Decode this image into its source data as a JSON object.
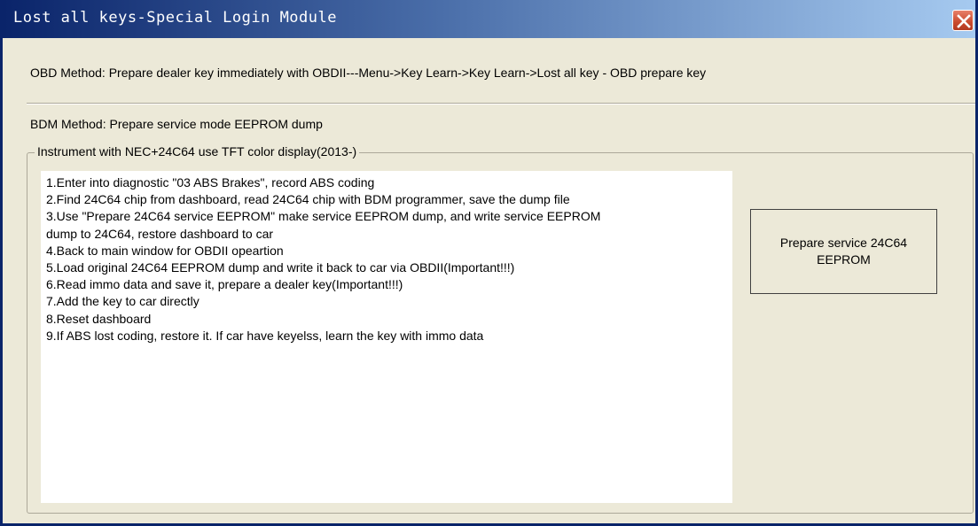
{
  "window": {
    "title": "Lost all keys-Special Login Module",
    "close_label": "Close"
  },
  "obd_method": "OBD Method: Prepare dealer key immediately with OBDII---Menu->Key Learn->Key Learn->Lost all key - OBD prepare key",
  "bdm_method": "BDM Method: Prepare service mode EEPROM dump",
  "group": {
    "title": "Instrument with NEC+24C64 use TFT color display(2013-)",
    "steps": [
      "1.Enter into diagnostic \"03 ABS Brakes\", record ABS coding",
      "2.Find 24C64 chip from dashboard, read 24C64 chip with BDM programmer, save the dump file",
      "3.Use \"Prepare 24C64 service EEPROM\" make service EEPROM dump, and write service EEPROM",
      "dump to 24C64, restore dashboard to car",
      "4.Back to main window for OBDII opeartion",
      "5.Load original 24C64 EEPROM dump and write it back to car via OBDII(Important!!!)",
      "6.Read immo data and save it, prepare a dealer key(Important!!!)",
      "7.Add the key to car directly",
      "8.Reset dashboard",
      "9.If ABS lost coding, restore it. If car have keyelss, learn the key with immo data"
    ],
    "button": {
      "line1": "Prepare service 24C64",
      "line2": "EEPROM"
    }
  },
  "colors": {
    "title_gradient_start": "#0a246a",
    "title_gradient_end": "#a6caf0",
    "window_bg": "#ece9d8",
    "close_button": "#c94a2e"
  },
  "icons": {
    "close": "close-icon"
  }
}
